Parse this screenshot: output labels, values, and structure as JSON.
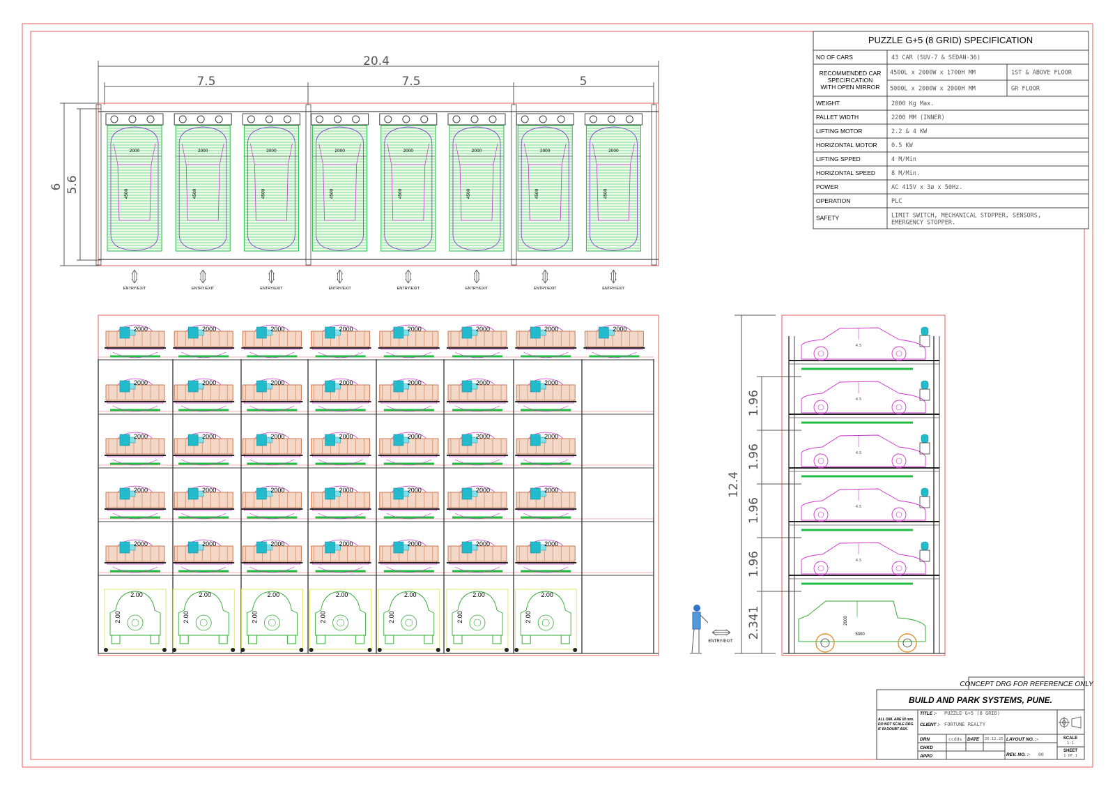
{
  "plan": {
    "overall_dim": "20.4",
    "segment_dims": [
      "7.5",
      "7.5",
      "5"
    ],
    "depth_dims": [
      "6",
      "5.6"
    ],
    "bays": 8,
    "bay_width_label": "2000",
    "bay_length_label": "4500",
    "entry_label": "ENTRY/EXIT"
  },
  "front_elevation": {
    "columns": 8,
    "upper_levels": 5,
    "top_level_bays": 8,
    "other_level_bays": 7,
    "car_label": "2000",
    "ground_bays": 7,
    "ground_label": "2.00",
    "person_entry_label": "ENTRY/EXIT"
  },
  "side_elevation": {
    "total_height": "12.4",
    "level_heights": [
      "1.96",
      "1.96",
      "1.96",
      "1.96"
    ],
    "ground_height": "2.341",
    "sedan_label": "4.5",
    "suv_length": "5000",
    "suv_height": "2000"
  },
  "spec": {
    "title": "PUZZLE G+5 (8 GRID)  SPECIFICATION",
    "rows": [
      {
        "label": "NO OF CARS",
        "value": "43 CAR (SUV-7 & SEDAN-36)"
      },
      {
        "label": "RECOMMENDED CAR SPECIFICATION WITH OPEN MIRROR",
        "label_lines": [
          "RECOMMENDED CAR",
          "SPECIFICATION",
          "WITH OPEN MIRROR"
        ],
        "sub": [
          {
            "value": "4500L x 2000W x 1700H MM",
            "note": "1ST & ABOVE FLOOR"
          },
          {
            "value": "5000L x 2000W x 2000H MM",
            "note": "GR FLOOR"
          }
        ]
      },
      {
        "label": "WEIGHT",
        "value": "2000 Kg Max."
      },
      {
        "label": "PALLET WIDTH",
        "value": "2200 MM (INNER)"
      },
      {
        "label": "LIFTING MOTOR",
        "value": "2.2 & 4 KW"
      },
      {
        "label": "HORIZONTAL MOTOR",
        "value": "0.5 KW"
      },
      {
        "label": "LIFTING SPPED",
        "value": "4 M/Min"
      },
      {
        "label": "HORIZONTAL SPEED",
        "value": "8 M/Min."
      },
      {
        "label": "POWER",
        "value": "AC 415V x 3ø x 50Hz."
      },
      {
        "label": "OPERATION",
        "value": "PLC"
      },
      {
        "label": "SAFETY",
        "value_lines": [
          "LIMIT SWITCH, MECHANICAL STOPPER, SENSORS,",
          "EMERGENCY STOPPER."
        ]
      }
    ]
  },
  "title_block": {
    "concept_note": "CONCEPT DRG FOR  REFERENCE ONLY",
    "company": "BUILD AND PARK SYSTEMS, PUNE.",
    "notes": [
      "ALL DIM. ARE IN mm.",
      "DO NOT SCALE DRG.",
      "IF IN DOUBT ASK."
    ],
    "title_label": "TITLE :-",
    "title_value": "PUZZLE G+5 (8 GRID)",
    "client_label": "CLIENT :-",
    "client_value": "FORTUNE REALTY",
    "drn_label": "DRN",
    "drn_value": "ccdds",
    "date_label": "DATE",
    "date_value": "26.12.25",
    "chkd_label": "CHKD",
    "appd_label": "APPD",
    "layout_label": "LAYOUT NO. :-",
    "rev_label": "REV. NO. :-",
    "rev_value": "00",
    "scale_label": "SCALE",
    "scale_value": "1:1",
    "sheet_label": "SHEET",
    "sheet_value": "1 OF 1"
  },
  "colors": {
    "frame": "#e06060",
    "structure": "#404040",
    "pallet_green": "#22bb44",
    "car_magenta": "#cc33cc",
    "car_purple": "#8844cc",
    "motor_cyan": "#22bbcc",
    "motor_brown": "#c87850",
    "suv_green": "#33aa33",
    "dim_grey": "#555555"
  }
}
